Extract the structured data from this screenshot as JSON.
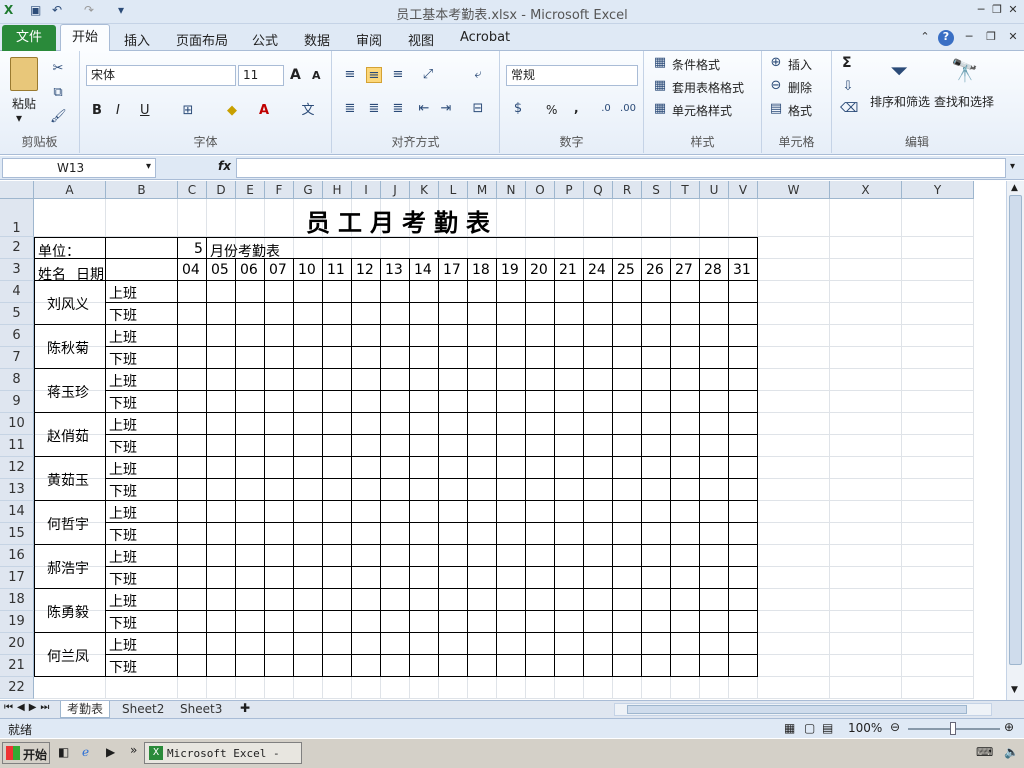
{
  "window": {
    "title": "员工基本考勤表.xlsx - Microsoft Excel"
  },
  "ribbon_tabs": [
    "文件",
    "开始",
    "插入",
    "页面布局",
    "公式",
    "数据",
    "审阅",
    "视图",
    "Acrobat"
  ],
  "ribbon": {
    "clipboard": {
      "paste": "粘贴",
      "label": "剪贴板"
    },
    "font": {
      "family": "宋体",
      "size": "11",
      "label": "字体",
      "bold": "B",
      "italic": "I",
      "underline": "U",
      "increase": "A",
      "decrease": "A"
    },
    "alignment": {
      "label": "对齐方式"
    },
    "number": {
      "format": "常规",
      "label": "数字",
      "percent": "%",
      "comma": ","
    },
    "styles": {
      "conditional": "条件格式",
      "table": "套用表格格式",
      "cell": "单元格样式",
      "label": "样式"
    },
    "cells": {
      "insert": "插入",
      "delete": "删除",
      "format": "格式",
      "label": "单元格"
    },
    "editing": {
      "sum": "Σ",
      "sort": "排序和筛选",
      "find": "查找和选择",
      "label": "编辑"
    }
  },
  "formula_bar": {
    "name_box": "W13",
    "fx": "fx",
    "content": ""
  },
  "sheet": {
    "columns": [
      "A",
      "B",
      "C",
      "D",
      "E",
      "F",
      "G",
      "H",
      "I",
      "J",
      "K",
      "L",
      "M",
      "N",
      "O",
      "P",
      "Q",
      "R",
      "S",
      "T",
      "U",
      "V",
      "W",
      "X",
      "Y"
    ],
    "rows": [
      "1",
      "2",
      "3",
      "4",
      "5",
      "6",
      "7",
      "8",
      "9",
      "10",
      "11",
      "12",
      "13",
      "14",
      "15",
      "16",
      "17",
      "18",
      "19",
      "20",
      "21",
      "22"
    ],
    "title": "员工月考勤表",
    "unit_label": "单位：",
    "month_value": "5",
    "month_label": "月份考勤表",
    "name_header": "姓名",
    "date_header": "日期",
    "dates": [
      "04",
      "05",
      "06",
      "07",
      "10",
      "11",
      "12",
      "13",
      "14",
      "17",
      "18",
      "19",
      "20",
      "21",
      "24",
      "25",
      "26",
      "27",
      "28",
      "31"
    ],
    "employees": [
      "刘风义",
      "陈秋菊",
      "蒋玉珍",
      "赵俏茹",
      "黄茹玉",
      "何哲宇",
      "郝浩宇",
      "陈勇毅",
      "何兰凤"
    ],
    "shift_on": "上班",
    "shift_off": "下班"
  },
  "sheet_tabs": [
    "考勤表",
    "Sheet2",
    "Sheet3"
  ],
  "status": {
    "ready": "就绪",
    "zoom": "100%"
  },
  "taskbar": {
    "start": "开始",
    "task": "Microsoft Excel - ..."
  }
}
